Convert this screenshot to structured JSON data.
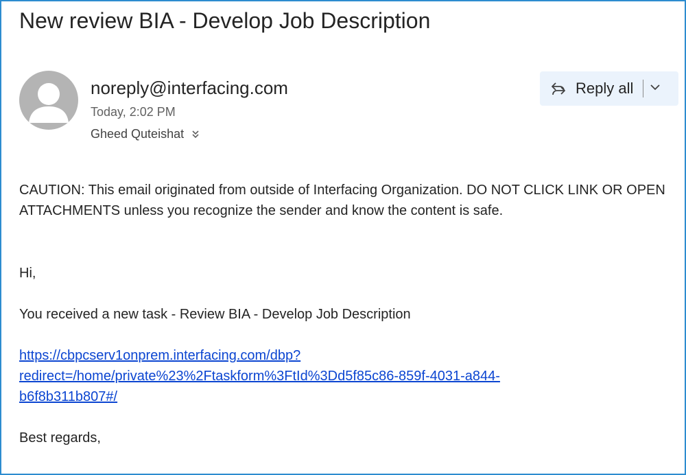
{
  "email": {
    "subject": "New review BIA - Develop Job Description",
    "sender": "noreply@interfacing.com",
    "time": "Today, 2:02 PM",
    "recipient": "Gheed Quteishat",
    "actions": {
      "reply_all_label": "Reply all"
    },
    "body": {
      "caution": "CAUTION: This email originated from outside of Interfacing Organization. DO NOT CLICK LINK OR OPEN ATTACHMENTS unless you recognize the sender and know the content is safe.",
      "greeting": "Hi,",
      "task_line": "You received a new task - Review BIA - Develop Job Description",
      "link_lines": [
        "https://cbpcserv1onprem.interfacing.com/dbp?",
        "redirect=/home/private%23%2Ftaskform%3FtId%3Dd5f85c86-859f-4031-a844-",
        "b6f8b311b807#/"
      ],
      "signoff": "Best regards,"
    }
  },
  "icons": {
    "avatar": "person-avatar-icon",
    "reply_all": "reply-all-icon",
    "dropdown": "chevron-down-icon",
    "expand_recipients": "double-chevron-down-icon"
  },
  "colors": {
    "frame_border": "#2d8ccf",
    "reply_group_bg": "#ebf3fc",
    "link": "#0b45d1",
    "avatar_bg": "#b4b4b4"
  }
}
